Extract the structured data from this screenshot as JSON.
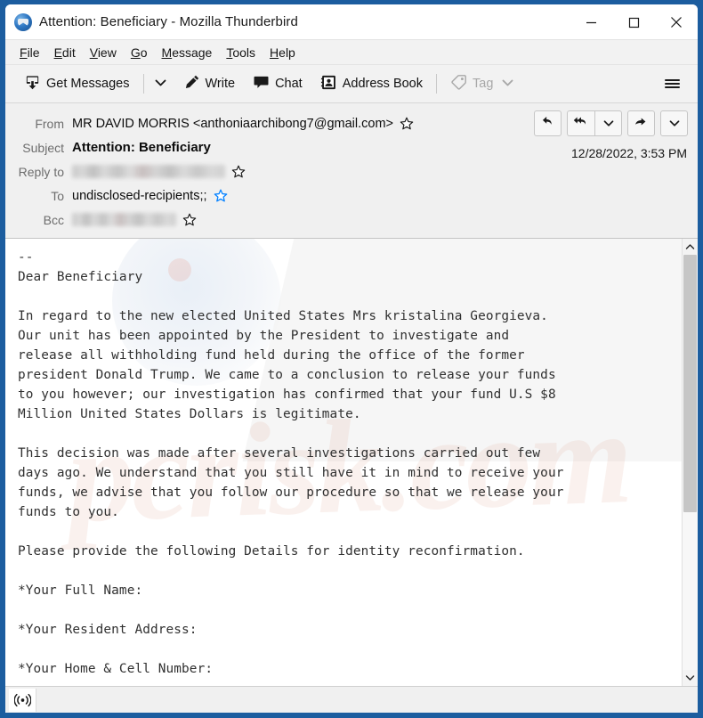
{
  "window": {
    "title": "Attention: Beneficiary - Mozilla Thunderbird",
    "app_icon": "thunderbird-logo-icon",
    "controls": {
      "minimize": "minimize-icon",
      "maximize": "maximize-icon",
      "close": "close-icon"
    },
    "border_color": "#1c5d9f"
  },
  "menubar": {
    "items": [
      {
        "label": "File",
        "accel": "F"
      },
      {
        "label": "Edit",
        "accel": "E"
      },
      {
        "label": "View",
        "accel": "V"
      },
      {
        "label": "Go",
        "accel": "G"
      },
      {
        "label": "Message",
        "accel": "M"
      },
      {
        "label": "Tools",
        "accel": "T"
      },
      {
        "label": "Help",
        "accel": "H"
      }
    ]
  },
  "toolbar": {
    "get_messages_label": "Get Messages",
    "get_messages_icon": "inbox-download-icon",
    "get_messages_caret": "chevron-down-icon",
    "write_label": "Write",
    "write_icon": "pencil-icon",
    "chat_label": "Chat",
    "chat_icon": "speech-bubble-icon",
    "address_book_label": "Address Book",
    "address_book_icon": "contact-card-icon",
    "tag_label": "Tag",
    "tag_icon": "tag-icon",
    "tag_caret": "chevron-down-icon",
    "tag_disabled": true,
    "app_menu_icon": "hamburger-menu-icon"
  },
  "message_header": {
    "rows": [
      {
        "label": "From",
        "value": "MR DAVID MORRIS <anthoniaarchibong7@gmail.com>",
        "star": "star-outline-icon",
        "starred": false,
        "redacted": false,
        "bold": false
      },
      {
        "label": "Subject",
        "value": "Attention: Beneficiary",
        "star": null,
        "starred": false,
        "redacted": false,
        "bold": true
      },
      {
        "label": "Reply to",
        "value": "",
        "star": "star-outline-icon",
        "starred": false,
        "redacted": true,
        "bold": false
      },
      {
        "label": "To",
        "value": "undisclosed-recipients;;",
        "star": "star-filled-icon",
        "starred": true,
        "redacted": false,
        "bold": false
      },
      {
        "label": "Bcc",
        "value": "",
        "star": "star-outline-icon",
        "starred": false,
        "redacted": true,
        "bold": false
      }
    ],
    "date": "12/28/2022, 3:53 PM",
    "actions": {
      "reply": "reply-icon",
      "reply_all": "reply-all-icon",
      "reply_all_caret": "chevron-down-icon",
      "forward": "forward-arrow-icon",
      "more_caret": "chevron-down-icon"
    },
    "star_filled_color": "#0a84ff"
  },
  "message_body": {
    "text": "--\nDear Beneficiary\n\nIn regard to the new elected United States Mrs kristalina Georgieva.\nOur unit has been appointed by the President to investigate and\nrelease all withholding fund held during the office of the former\npresident Donald Trump. We came to a conclusion to release your funds\nto you however; our investigation has confirmed that your fund U.S $8\nMillion United States Dollars is legitimate.\n\nThis decision was made after several investigations carried out few\ndays ago. We understand that you still have it in mind to receive your\nfunds, we advise that you follow our procedure so that we release your\nfunds to you.\n\nPlease provide the following Details for identity reconfirmation.\n\n*Your Full Name:\n\n*Your Resident Address:\n\n*Your Home & Cell Number:",
    "watermark": "pcrisk.com"
  },
  "scrollbar": {
    "up_arrow": "chevron-up-icon",
    "down_arrow": "chevron-down-icon",
    "thumb_position_percent": 0,
    "thumb_size_percent": 62
  },
  "statusbar": {
    "connection_icon": "broadcast-signal-icon",
    "text": ""
  }
}
